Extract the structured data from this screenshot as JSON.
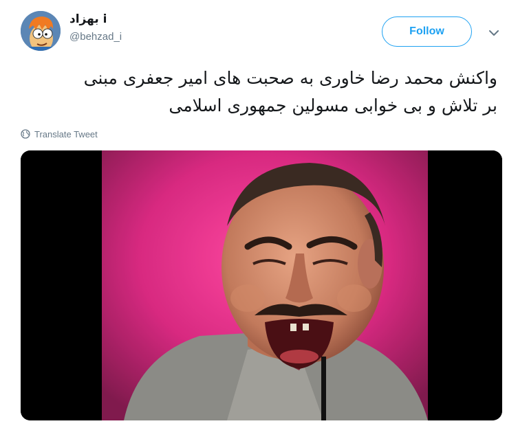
{
  "user": {
    "display_name": "بهزاد i",
    "handle": "@behzad_i",
    "avatar_icon": "cartoon-avatar-icon"
  },
  "actions": {
    "follow_label": "Follow",
    "menu_icon": "chevron-down-icon"
  },
  "tweet": {
    "text_line1": "واکنش محمد رضا خاوری به صحبت های امیر جعفری مبنی",
    "text_line2": "بر تلاش و بی خوابی مسولین جمهوری اسلامی",
    "translate_label": "Translate Tweet",
    "translate_icon": "globe-icon"
  },
  "colors": {
    "accent": "#1da1f2",
    "secondary_text": "#657786",
    "primary_text": "#14171a"
  }
}
